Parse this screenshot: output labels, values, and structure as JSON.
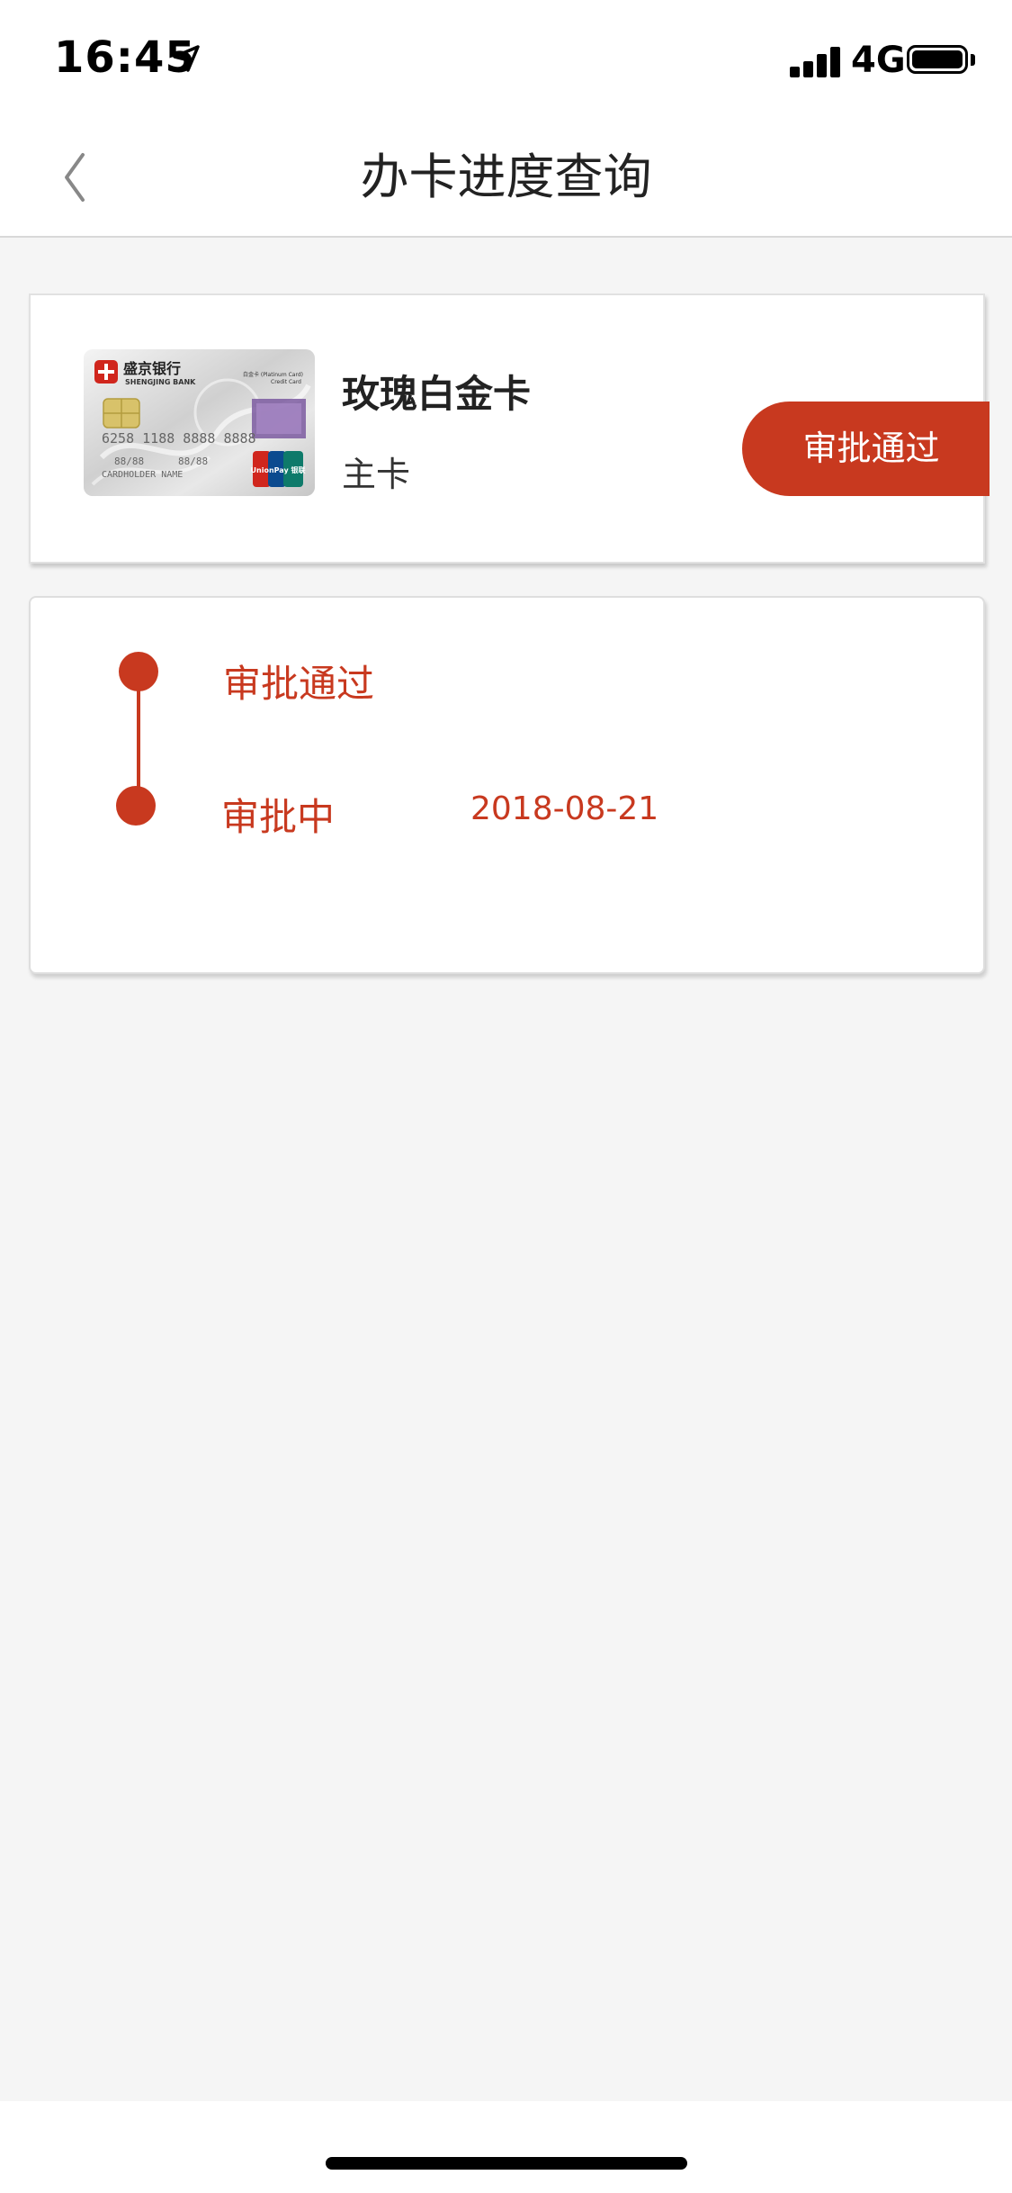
{
  "status_bar": {
    "time": "16:45",
    "network": "4G"
  },
  "nav": {
    "title": "办卡进度查询"
  },
  "card": {
    "name": "玫瑰白金卡",
    "type": "主卡",
    "status": "审批通过",
    "image": {
      "bank_name_cn": "盛京银行",
      "bank_name_en": "SHENGJING BANK",
      "card_tier": "白金卡 (Platinum Card)",
      "card_kind": "Credit Card",
      "card_number": "6258 1188 8888 8888",
      "valid_from": "88/88",
      "valid_thru": "88/88",
      "holder": "CARDHOLDER NAME",
      "network_logo": "UnionPay 银联"
    }
  },
  "progress": {
    "steps": [
      {
        "label": "审批通过",
        "date": ""
      },
      {
        "label": "审批中",
        "date": "2018-08-21"
      }
    ]
  },
  "colors": {
    "accent": "#c8391f",
    "background": "#f5f5f5"
  },
  "icons": {
    "back": "chevron-left-icon",
    "location": "location-arrow-icon",
    "signal": "cellular-signal-icon",
    "battery": "battery-icon"
  }
}
